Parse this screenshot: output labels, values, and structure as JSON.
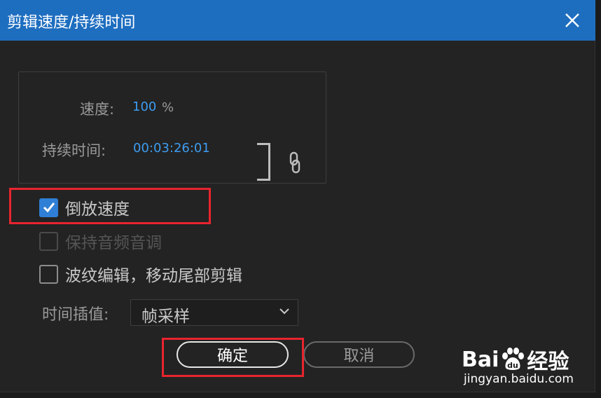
{
  "window": {
    "title": "剪辑速度/持续时间",
    "close_icon": "close-icon"
  },
  "speed": {
    "label": "速度:",
    "value": "100",
    "unit": "%"
  },
  "duration": {
    "label": "持续时间:",
    "value": "00:03:26:01"
  },
  "link_icon": "chain-link-icon",
  "checkboxes": [
    {
      "label": "倒放速度",
      "checked": true,
      "enabled": true
    },
    {
      "label": "保持音频音调",
      "checked": false,
      "enabled": false
    },
    {
      "label": "波纹编辑，移动尾部剪辑",
      "checked": false,
      "enabled": true
    }
  ],
  "interpolation": {
    "label": "时间插值:",
    "value": "帧采样"
  },
  "buttons": {
    "ok": "确定",
    "cancel": "取消"
  },
  "watermark": {
    "brand_left": "Bai",
    "brand_paw_text": "du",
    "brand_right": "经验",
    "url": "jingyan.baidu.com"
  },
  "colors": {
    "title_bar": "#1e6ec0",
    "accent_value": "#3d9cf0",
    "checkbox_checked": "#2f7fd6",
    "highlight": "#e8242e",
    "background": "#232323"
  }
}
